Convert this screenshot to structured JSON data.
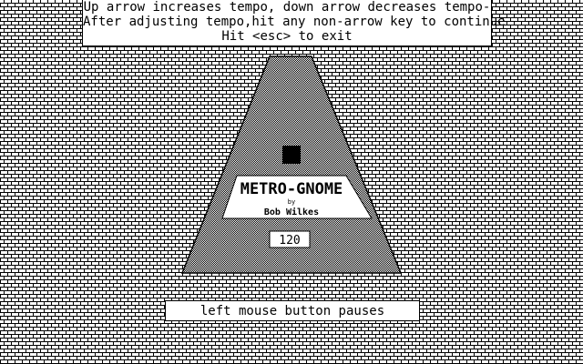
{
  "instructions": {
    "line1": "Up arrow increases tempo, down arrow decreases tempo-",
    "line2": "After adjusting tempo,hit any non-arrow key to continue",
    "line3": "Hit <esc> to exit"
  },
  "metronome": {
    "title": "METRO-GNOME",
    "by": "by",
    "author": "Bob Wilkes",
    "tempo": "120"
  },
  "footer": {
    "pause_hint": "left mouse button pauses"
  },
  "colors": {
    "foreground": "#000000",
    "background": "#ffffff"
  }
}
